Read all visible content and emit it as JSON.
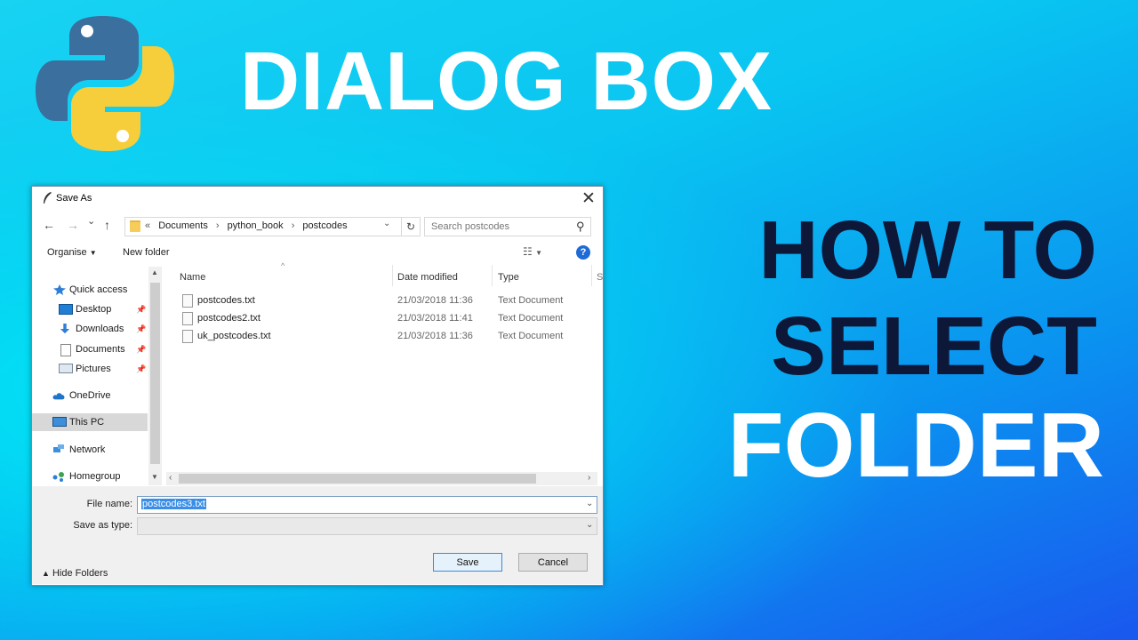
{
  "titles": {
    "line1": "DIALOG BOX",
    "line2": "HOW TO",
    "line3": "SELECT",
    "line4": "FOLDER"
  },
  "logo": {
    "icon": "python-logo",
    "colors": {
      "blue": "#3a6f9e",
      "yellow": "#f6cd3b"
    }
  },
  "dialog": {
    "title": "Save As",
    "close": "✕",
    "nav": {
      "back": "←",
      "forward": "→",
      "down": "⌄",
      "up": "↑"
    },
    "address": {
      "prefix": "«",
      "crumbs": [
        "Documents",
        "python_book",
        "postcodes"
      ],
      "separator": "›",
      "dropdown": "⌄",
      "refresh": "↻"
    },
    "search": {
      "placeholder": "Search postcodes",
      "icon": "⚲"
    },
    "toolbar": {
      "organise": "Organise",
      "new_folder": "New folder",
      "help": "?"
    },
    "sidebar": [
      {
        "label": "Quick access",
        "icon": "star-icon"
      },
      {
        "label": "Desktop",
        "icon": "desktop-icon",
        "pinned": true
      },
      {
        "label": "Downloads",
        "icon": "downloads-icon",
        "pinned": true
      },
      {
        "label": "Documents",
        "icon": "documents-icon",
        "pinned": true
      },
      {
        "label": "Pictures",
        "icon": "pictures-icon",
        "pinned": true
      },
      {
        "label": "OneDrive",
        "icon": "onedrive-icon"
      },
      {
        "label": "This PC",
        "icon": "this-pc-icon",
        "selected": true
      },
      {
        "label": "Network",
        "icon": "network-icon"
      },
      {
        "label": "Homegroup",
        "icon": "homegroup-icon"
      }
    ],
    "columns": {
      "name": "Name",
      "date": "Date modified",
      "type": "Type",
      "size": "S"
    },
    "files": [
      {
        "name": "postcodes.txt",
        "date": "21/03/2018 11:36",
        "type": "Text Document"
      },
      {
        "name": "postcodes2.txt",
        "date": "21/03/2018 11:41",
        "type": "Text Document"
      },
      {
        "name": "uk_postcodes.txt",
        "date": "21/03/2018 11:36",
        "type": "Text Document"
      }
    ],
    "form": {
      "file_name_label": "File name:",
      "file_name_value": "postcodes3.txt",
      "save_type_label": "Save as type:",
      "save_type_value": "",
      "hide_folders": "Hide Folders",
      "save": "Save",
      "cancel": "Cancel"
    }
  }
}
